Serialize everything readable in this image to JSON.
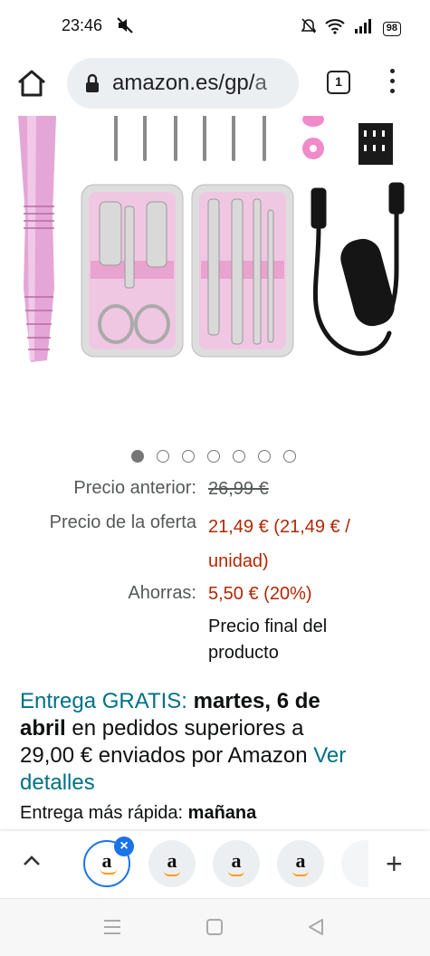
{
  "status": {
    "time": "23:46",
    "battery": "98"
  },
  "browser": {
    "url_main": "amazon.es/gp/",
    "url_tail": "a",
    "tab_count": "1"
  },
  "carousel": {
    "total": 7,
    "active": 0
  },
  "price": {
    "old_label": "Precio anterior:",
    "old_value": "26,99 €",
    "deal_label": "Precio de la oferta",
    "deal_value": "21,49 € (21,49 € /",
    "deal_value_2": "unidad)",
    "save_label": "Ahorras:",
    "save_value": "5,50 € (20%)",
    "final_line1": "Precio final del",
    "final_line2": "producto"
  },
  "delivery": {
    "free_label": "Entrega GRATIS:",
    "date_line1": "martes, 6 de",
    "date_line2": "abril",
    "text1": "en pedidos superiores a",
    "text2": "29,00 € enviados por Amazon",
    "details_1": "Ver",
    "details_2": "detalles"
  },
  "faster": {
    "label": "Entrega más rápida:",
    "value": "mañana"
  },
  "tabs": {
    "logo": "a",
    "close": "×",
    "add": "+"
  },
  "colors": {
    "price_red": "#b12704",
    "link_teal": "#007185",
    "accent_blue": "#1a73e8",
    "product_pink": "#e9a9d6"
  }
}
